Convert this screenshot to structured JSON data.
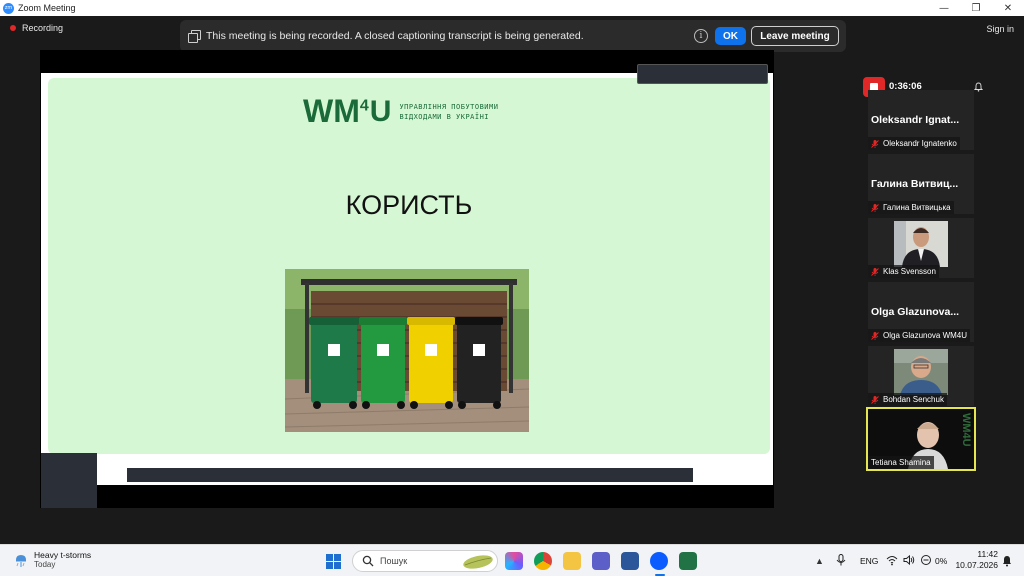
{
  "window": {
    "title": "Zoom Meeting",
    "controls": {
      "minimize": "—",
      "maximize": "❐",
      "close": "✕"
    },
    "app_icon_text": "zm"
  },
  "meeting": {
    "recording_label": "Recording",
    "signin_label": "Sign in",
    "banner": {
      "message": "This meeting is being recorded. A closed captioning transcript is being generated.",
      "info_glyph": "i",
      "ok_label": "OK",
      "leave_label": "Leave meeting"
    },
    "timer": "0:36:06"
  },
  "slide": {
    "logo_main": "WM",
    "logo_sup": "4",
    "logo_arrow": "U",
    "logo_line1": "УПРАВЛІННЯ ПОБУТОВИМИ",
    "logo_line2": "ВІДХОДАМИ В УКРАЇНІ",
    "heading": "КОРИСТЬ"
  },
  "participants": [
    {
      "big_name": "Oleksandr Ignat...",
      "label": "Oleksandr Ignatenko",
      "video": false,
      "muted": true
    },
    {
      "big_name": "Галина Витвиц...",
      "label": "Галина Витвицька",
      "video": false,
      "muted": true
    },
    {
      "big_name": "",
      "label": "Klas Svensson",
      "video": true,
      "muted": true
    },
    {
      "big_name": "Olga Glazunova...",
      "label": "Olga Glazunova WM4U",
      "video": false,
      "muted": true
    },
    {
      "big_name": "",
      "label": "Bohdan Senchuk",
      "video": true,
      "muted": true
    },
    {
      "big_name": "",
      "label": "Tetiana Shamina",
      "video": true,
      "muted": false,
      "active": true
    }
  ],
  "active_tile_watermark": "WM4U",
  "taskbar": {
    "weather_title": "Heavy t-storms",
    "weather_sub": "Today",
    "search_placeholder": "Пошук",
    "lang": "ENG",
    "battery": "0%",
    "time": "11:42",
    "date": "10.07.2026"
  }
}
